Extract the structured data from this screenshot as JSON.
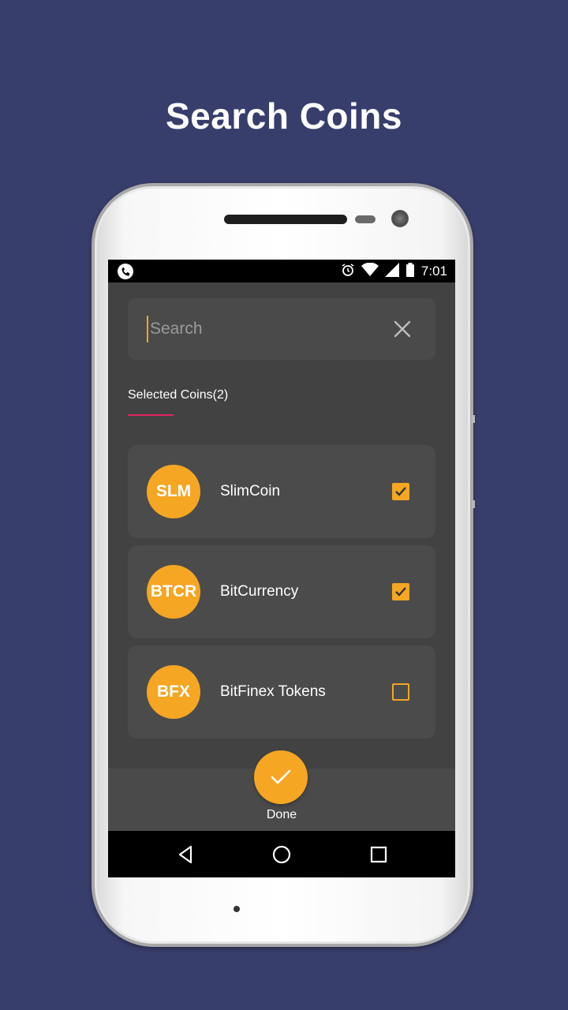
{
  "headline": "Search Coins",
  "status_bar": {
    "time": "7:01",
    "icons": [
      "phone-icon",
      "alarm-icon",
      "wifi-icon",
      "signal-icon",
      "battery-icon"
    ]
  },
  "search": {
    "placeholder": "Search",
    "value": ""
  },
  "section": {
    "label": "Selected Coins(2)"
  },
  "coins": [
    {
      "symbol": "SLM",
      "name": "SlimCoin",
      "checked": true
    },
    {
      "symbol": "BTCR",
      "name": "BitCurrency",
      "checked": true
    },
    {
      "symbol": "BFX",
      "name": "BitFinex Tokens",
      "checked": false
    }
  ],
  "done": {
    "label": "Done"
  },
  "colors": {
    "background": "#383e6b",
    "accent": "#f5a623",
    "underline": "#e0245e",
    "card": "#4b4b4b"
  }
}
